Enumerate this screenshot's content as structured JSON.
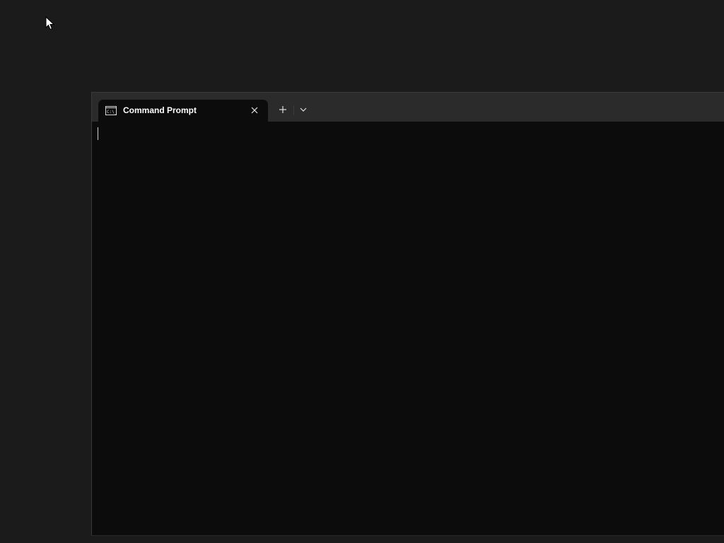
{
  "window": {
    "tab": {
      "title": "Command Prompt",
      "icon": "cmd-icon",
      "close_icon": "close-icon"
    },
    "new_tab_icon": "plus-icon",
    "dropdown_icon": "chevron-down-icon"
  },
  "colors": {
    "desktop": "#1b1b1b",
    "tab_strip": "#2b2b2b",
    "terminal_background": "#0c0c0c",
    "text": "#ffffff"
  },
  "terminal": {
    "output": ""
  }
}
